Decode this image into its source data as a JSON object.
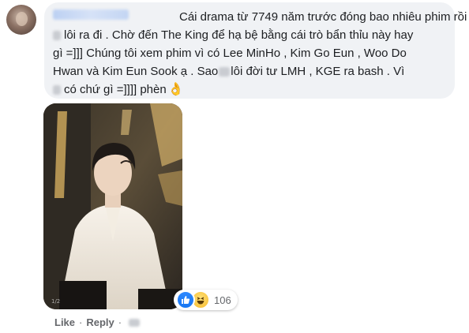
{
  "comment": {
    "lines": [
      "Cái drama từ 7749 năm trước đóng bao nhiêu phim rồi",
      "lôi ra đi . Chờ đến The King để hạ bệ bằng cái trò bẩn thỉu này hay",
      "gì =]]] Chúng tôi xem phim vì có Lee MinHo , Kim Go Eun , Woo Do",
      "Hwan và Kim Eun Sook ạ . Sao",
      "lôi đời tư LMH , KGE ra bash . Vì",
      "có chứ gì =]]]] phèn"
    ]
  },
  "reactions": {
    "count": "106",
    "types": [
      "like-icon",
      "haha-icon"
    ]
  },
  "actions": {
    "like_label": "Like",
    "reply_label": "Reply",
    "separator": "·"
  },
  "colors": {
    "bubble_bg": "#f0f2f5",
    "text": "#1c1e21",
    "secondary": "#65676b",
    "like_blue": "#1877f2",
    "haha_yellow": "#f7b928"
  }
}
